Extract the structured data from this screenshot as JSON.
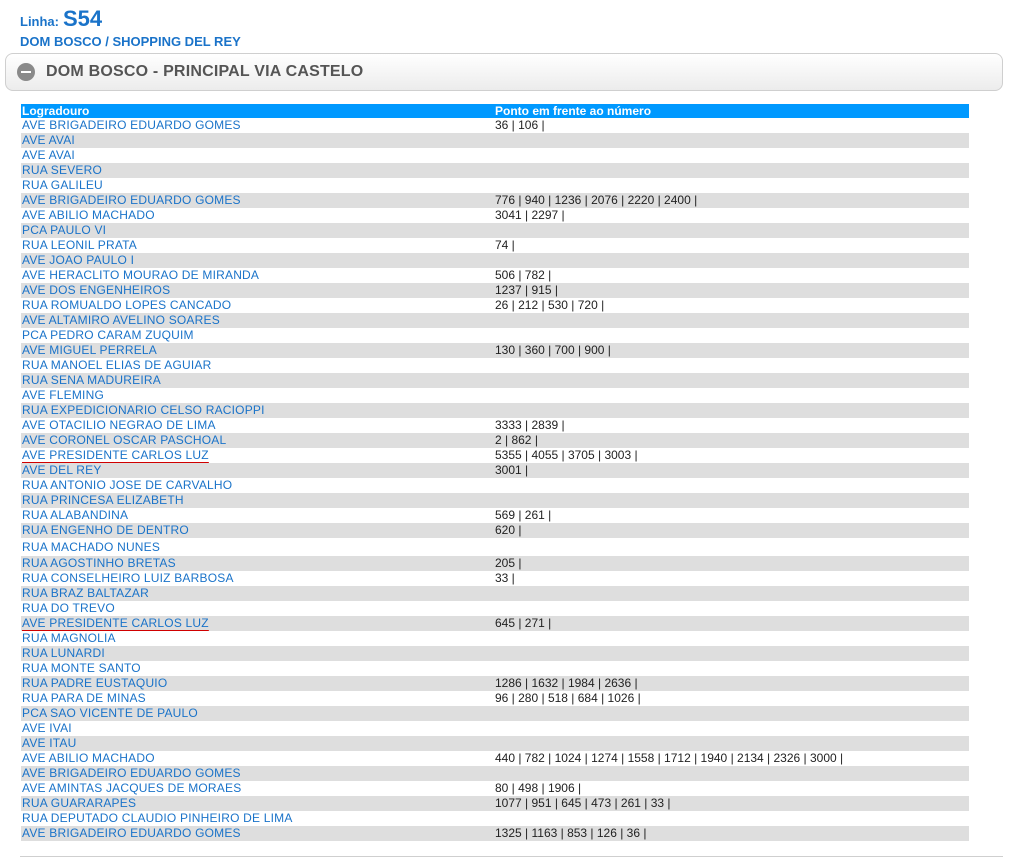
{
  "line": {
    "label": "Linha:",
    "code": "S54",
    "route": "DOM BOSCO / SHOPPING DEL REY"
  },
  "section": {
    "title": "DOM BOSCO - PRINCIPAL VIA CASTELO",
    "icon": "minus-circle-icon"
  },
  "table": {
    "headers": [
      "Logradouro",
      "Ponto em frente ao número"
    ],
    "rows": [
      {
        "street": "AVE BRIGADEIRO EDUARDO GOMES",
        "numbers": "36 | 106 |"
      },
      {
        "street": "AVE AVAI",
        "numbers": ""
      },
      {
        "street": "AVE AVAI",
        "numbers": ""
      },
      {
        "street": "RUA SEVERO",
        "numbers": ""
      },
      {
        "street": "RUA GALILEU",
        "numbers": ""
      },
      {
        "street": "AVE BRIGADEIRO EDUARDO GOMES",
        "numbers": "776 | 940 | 1236 | 2076 | 2220 | 2400 |"
      },
      {
        "street": "AVE ABILIO MACHADO",
        "numbers": "3041 | 2297 |"
      },
      {
        "street": "PCA PAULO VI",
        "numbers": ""
      },
      {
        "street": "RUA LEONIL PRATA",
        "numbers": "74 |"
      },
      {
        "street": "AVE JOAO PAULO I",
        "numbers": ""
      },
      {
        "street": "AVE HERACLITO MOURAO DE MIRANDA",
        "numbers": "506 | 782 |"
      },
      {
        "street": "AVE DOS ENGENHEIROS",
        "numbers": "1237 | 915 |"
      },
      {
        "street": "RUA ROMUALDO LOPES CANCADO",
        "numbers": "26 | 212 | 530 | 720 |"
      },
      {
        "street": "AVE ALTAMIRO AVELINO SOARES",
        "numbers": ""
      },
      {
        "street": "PCA PEDRO CARAM ZUQUIM",
        "numbers": ""
      },
      {
        "street": "AVE MIGUEL PERRELA",
        "numbers": "130 | 360 | 700 | 900 |"
      },
      {
        "street": "RUA MANOEL ELIAS DE AGUIAR",
        "numbers": ""
      },
      {
        "street": "RUA SENA MADUREIRA",
        "numbers": ""
      },
      {
        "street": "AVE FLEMING",
        "numbers": ""
      },
      {
        "street": "RUA EXPEDICIONARIO CELSO RACIOPPI",
        "numbers": ""
      },
      {
        "street": "AVE OTACILIO NEGRAO DE LIMA",
        "numbers": "3333 | 2839 |"
      },
      {
        "street": "AVE CORONEL OSCAR PASCHOAL",
        "numbers": "2 | 862 |"
      },
      {
        "street": "AVE PRESIDENTE CARLOS LUZ",
        "numbers": "5355 | 4055 | 3705 | 3003 |",
        "underline": true
      },
      {
        "street": "AVE DEL REY",
        "numbers": "3001 |"
      },
      {
        "street": "RUA ANTONIO JOSE DE CARVALHO",
        "numbers": ""
      },
      {
        "street": "RUA PRINCESA ELIZABETH",
        "numbers": ""
      },
      {
        "street": "RUA ALABANDINA",
        "numbers": "569 | 261 |"
      },
      {
        "street": "RUA ENGENHO DE DENTRO",
        "numbers": "620 |"
      },
      {
        "street": "RUA MACHADO NUNES",
        "numbers": "",
        "tall": true
      },
      {
        "street": "RUA AGOSTINHO BRETAS",
        "numbers": "205 |"
      },
      {
        "street": "RUA CONSELHEIRO LUIZ BARBOSA",
        "numbers": "33 |"
      },
      {
        "street": "RUA BRAZ BALTAZAR",
        "numbers": ""
      },
      {
        "street": "RUA DO TREVO",
        "numbers": ""
      },
      {
        "street": "AVE PRESIDENTE CARLOS LUZ",
        "numbers": "645 | 271 |",
        "underline": true
      },
      {
        "street": "RUA MAGNOLIA",
        "numbers": ""
      },
      {
        "street": "RUA LUNARDI",
        "numbers": ""
      },
      {
        "street": "RUA MONTE SANTO",
        "numbers": ""
      },
      {
        "street": "RUA PADRE EUSTAQUIO",
        "numbers": "1286 | 1632 | 1984 | 2636 |"
      },
      {
        "street": "RUA PARA DE MINAS",
        "numbers": "96 | 280 | 518 | 684 | 1026 |"
      },
      {
        "street": "PCA SAO VICENTE DE PAULO",
        "numbers": ""
      },
      {
        "street": "AVE IVAI",
        "numbers": ""
      },
      {
        "street": "AVE ITAU",
        "numbers": ""
      },
      {
        "street": "AVE ABILIO MACHADO",
        "numbers": "440 | 782 | 1024 | 1274 | 1558 | 1712 | 1940 | 2134 | 2326 | 3000 |"
      },
      {
        "street": "AVE BRIGADEIRO EDUARDO GOMES",
        "numbers": ""
      },
      {
        "street": "AVE AMINTAS JACQUES DE MORAES",
        "numbers": "80 | 498 | 1906 |"
      },
      {
        "street": "RUA GUARARAPES",
        "numbers": "1077 | 951 | 645 | 473 | 261 | 33 |"
      },
      {
        "street": "RUA DEPUTADO CLAUDIO PINHEIRO DE LIMA",
        "numbers": ""
      },
      {
        "street": "AVE BRIGADEIRO EDUARDO GOMES",
        "numbers": "1325 | 1163 | 853 | 126 | 36 |"
      }
    ]
  },
  "colors": {
    "link": "#1a73c9",
    "header_bg": "#0099ff",
    "stripe": "#dedede"
  }
}
